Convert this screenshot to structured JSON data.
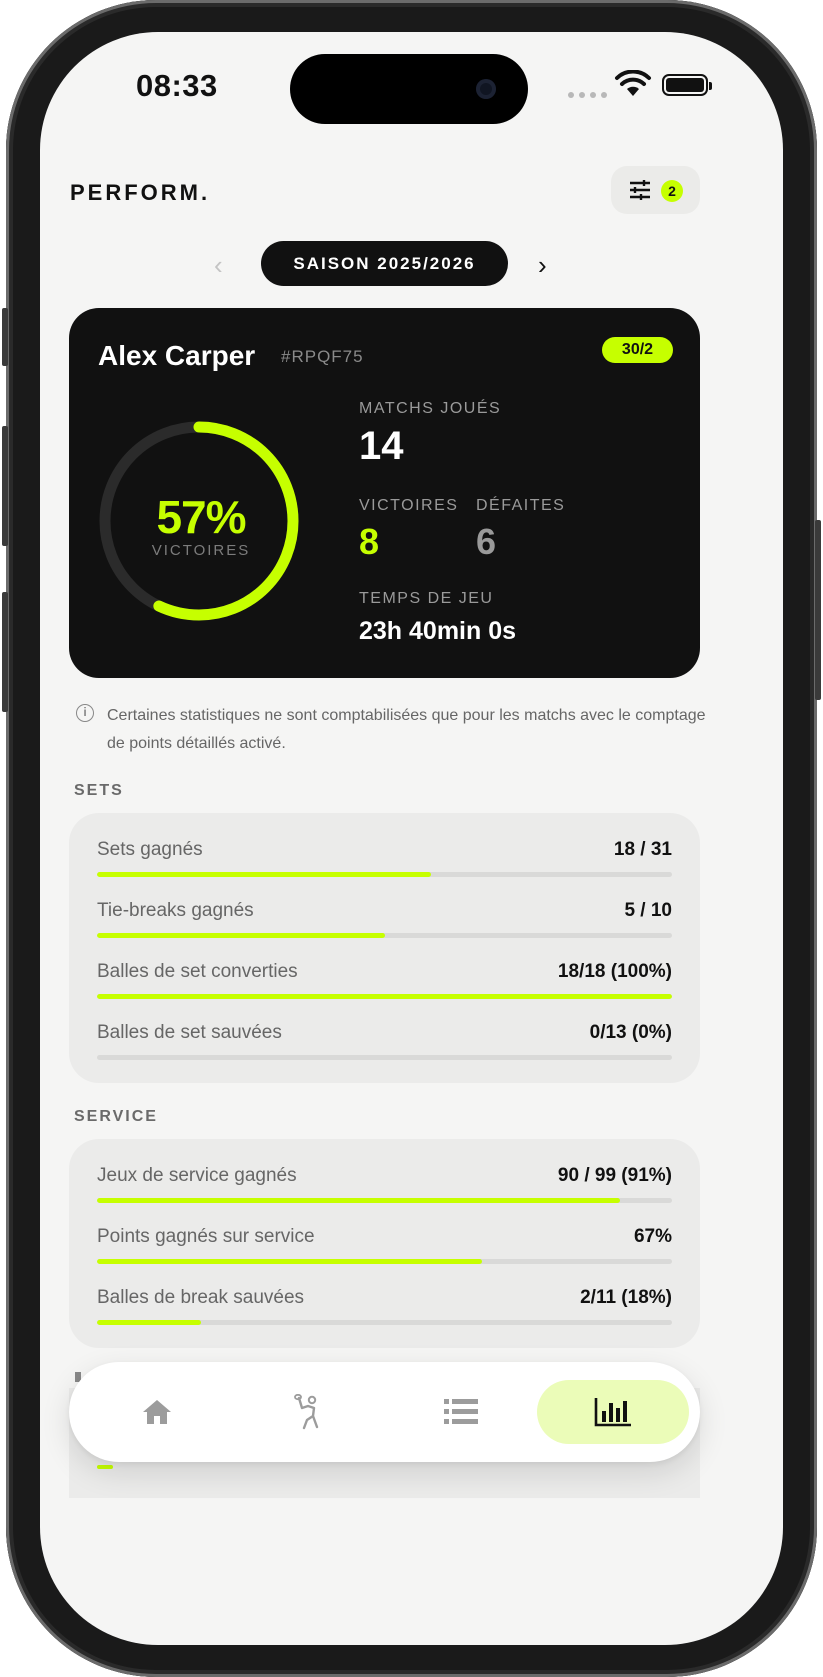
{
  "status_bar": {
    "time": "08:33"
  },
  "header": {
    "logo": "PERFORM.",
    "filter_count": "2"
  },
  "season": {
    "label": "SAISON 2025/2026",
    "prev": "‹",
    "next": "›"
  },
  "player": {
    "name": "Alex Carper",
    "id": "#RPQF75",
    "ranking": "30/2",
    "win_rate": 0.57,
    "win_rate_label": "57%",
    "win_rate_caption": "VICTOIRES",
    "matches_label": "MATCHS JOUÉS",
    "matches_value": "14",
    "wins_label": "VICTOIRES",
    "wins_value": "8",
    "losses_label": "DÉFAITES",
    "losses_value": "6",
    "playtime_label": "TEMPS DE JEU",
    "playtime_value": "23h 40min 0s"
  },
  "info_note": "Certaines statistiques ne sont comptabilisées que pour les matchs avec le comptage de points détaillés activé.",
  "sections": {
    "sets": {
      "title": "SETS",
      "rows": [
        {
          "label": "Sets gagnés",
          "value": "18 / 31",
          "progress": 0.58
        },
        {
          "label": "Tie-breaks gagnés",
          "value": "5 / 10",
          "progress": 0.5
        },
        {
          "label": "Balles de set converties",
          "value": "18/18 (100%)",
          "progress": 1.0
        },
        {
          "label": "Balles de set sauvées",
          "value": "0/13 (0%)",
          "progress": 0.0
        }
      ]
    },
    "service": {
      "title": "SERVICE",
      "rows": [
        {
          "label": "Jeux de service gagnés",
          "value": "90 / 99 (91%)",
          "progress": 0.91
        },
        {
          "label": "Points gagnés sur service",
          "value": "67%",
          "progress": 0.67
        },
        {
          "label": "Balles de break sauvées",
          "value": "2/11 (18%)",
          "progress": 0.18
        }
      ]
    }
  },
  "nav": {
    "items": [
      {
        "icon": "home-icon",
        "active": false
      },
      {
        "icon": "tennis-player-icon",
        "active": false
      },
      {
        "icon": "list-icon",
        "active": false
      },
      {
        "icon": "bar-chart-icon",
        "active": true
      }
    ]
  },
  "colors": {
    "accent": "#c6ff00",
    "card_bg": "#111111",
    "page_bg": "#f5f5f4",
    "panel_bg": "#ebebea"
  }
}
